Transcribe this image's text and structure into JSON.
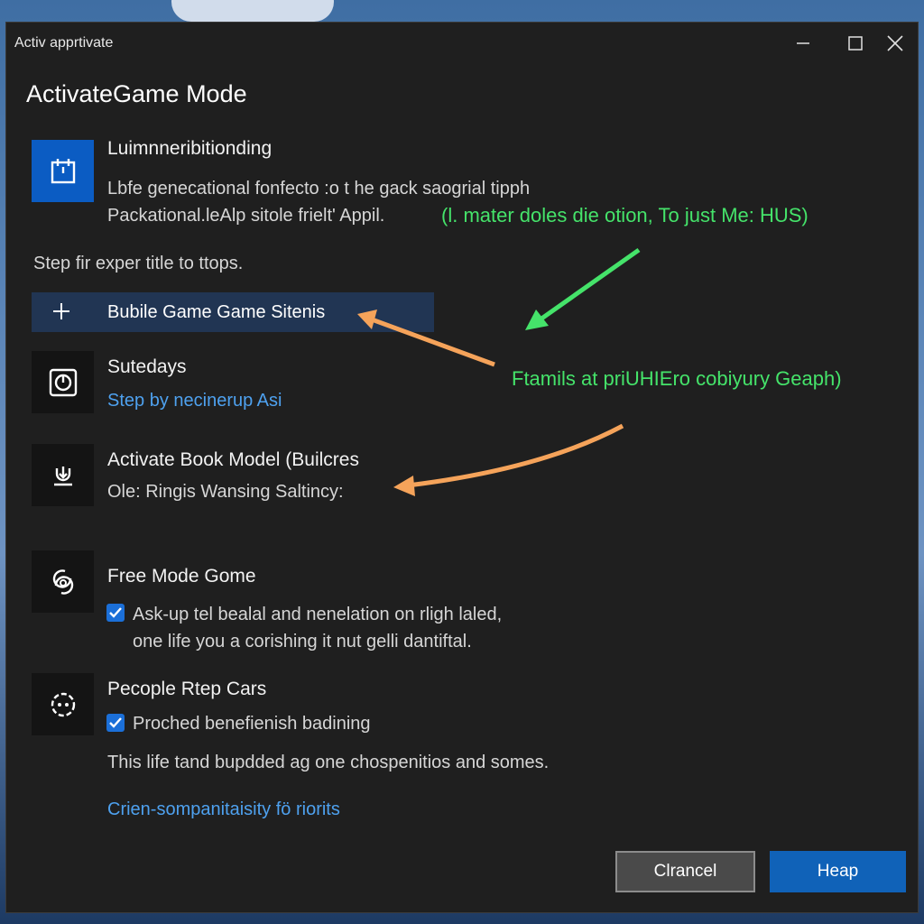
{
  "window": {
    "title": "Activ apprtivate",
    "heading": "ActivateGame Mode"
  },
  "intro": {
    "title": "Luimnneribitionding",
    "line1": "Lbfe genecational fonfecto :o t he gack saogrial tipph",
    "line2": "Packational.leAlp sitole frielt' Appil.",
    "note": "(l. mater doles die otion, To just Me: HUS)"
  },
  "step_text": "Step fir exper title to ttops.",
  "add_item": {
    "label": "Bubile Game Game Sitenis"
  },
  "annotation": "Ftamils at priUHIEro cobiyury Geaph)",
  "items": [
    {
      "title": "Sutedays",
      "subtitle": "Step by necinerup Asi"
    },
    {
      "title": "Activate Book Model (Builcres",
      "subtitle": "Ole: Ringis Wansing Saltincy:"
    },
    {
      "title": "Free Mode Gome",
      "check_line1": "Ask-up tel bealal and nenelation on rligh laled,",
      "check_line2": "one life you a corishing it nut gelli dantiftal."
    },
    {
      "title": "Pecople Rtep Cars",
      "check_line1": "Proched benefienish badining"
    }
  ],
  "footer_text": "This life tand bupdded ag one chospenitios and somes.",
  "footer_link": "Crien-sompanitaisity fö riorits",
  "buttons": {
    "cancel": "Clrancel",
    "help": "Heap"
  },
  "colors": {
    "accent": "#1062b8",
    "link": "#4ea1ef",
    "annotation_green": "#45e36a",
    "arrow_orange": "#f5a35a"
  }
}
